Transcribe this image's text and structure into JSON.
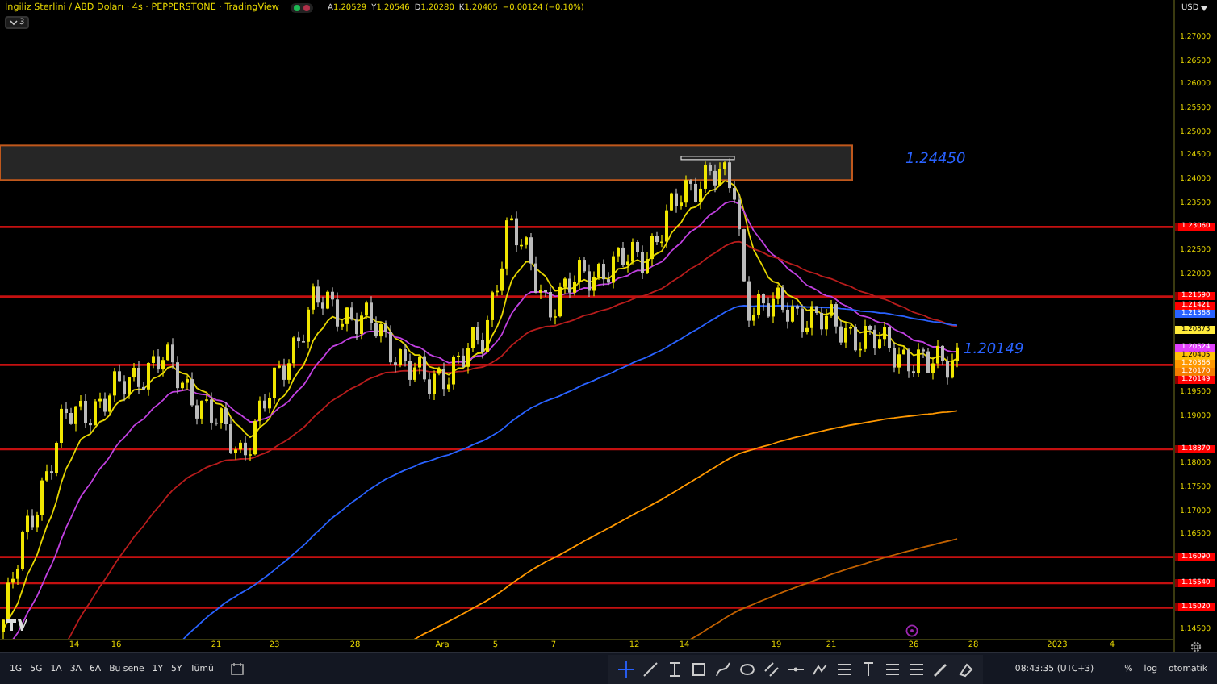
{
  "header": {
    "title": "İngiliz Sterlini / ABD Doları · 4s · PEPPERSTONE · TradingView",
    "market_open": true,
    "ohlc": [
      {
        "label": "A",
        "value": "1.20529"
      },
      {
        "label": "Y",
        "value": "1.20546"
      },
      {
        "label": "D",
        "value": "1.20280"
      },
      {
        "label": "K",
        "value": "1.20405"
      },
      {
        "value": "−0.00124 (−0.10%)"
      }
    ],
    "indicators_toggle": "3"
  },
  "chart": {
    "zone_label": "1.24450",
    "level_label": "1.20149"
  },
  "price_axis": {
    "currency": "USD",
    "ticks": [
      "1.27000",
      "1.26500",
      "1.26000",
      "1.25500",
      "1.25000",
      "1.24500",
      "1.24000",
      "1.23500",
      "1.22500",
      "1.22000",
      "1.19500",
      "1.19000",
      "1.18000",
      "1.17500",
      "1.17000",
      "1.16500",
      "1.14500"
    ],
    "badges": [
      {
        "value": "1.23060",
        "color": "#ff0000",
        "line": true
      },
      {
        "value": "1.21590",
        "color": "#ff0000",
        "line": true
      },
      {
        "value": "1.21421",
        "color": "#ff0000",
        "line": false
      },
      {
        "value": "1.21368",
        "color": "#2962ff",
        "line": false
      },
      {
        "value": "1.20873",
        "color": "#ffeb3b",
        "line": false
      },
      {
        "value": "1.20524",
        "color": "#e040fb",
        "line": false
      },
      {
        "value": "1.20405",
        "color": "#ffc107",
        "line": false
      },
      {
        "value": "1.20366",
        "color": "#ff9800",
        "line": false
      },
      {
        "value": "1.20170",
        "color": "#f57c00",
        "line": false
      },
      {
        "value": "1.20149",
        "color": "#ff0000",
        "line": true
      },
      {
        "value": "1.18370",
        "color": "#ff0000",
        "line": true
      },
      {
        "value": "1.16090",
        "color": "#ff0000",
        "line": true
      },
      {
        "value": "1.15540",
        "color": "#ff0000",
        "line": true
      },
      {
        "value": "1.15020",
        "color": "#ff0000",
        "line": true
      }
    ]
  },
  "time_axis": [
    "14",
    "16",
    "21",
    "23",
    "28",
    "Ara",
    "5",
    "7",
    "12",
    "14",
    "19",
    "21",
    "26",
    "28",
    "2023",
    "4"
  ],
  "bottom_bar": {
    "ranges": [
      "1G",
      "5G",
      "1A",
      "3A",
      "6A",
      "Bu sene",
      "1Y",
      "5Y",
      "Tümü"
    ],
    "clock": "08:43:35 (UTC+3)",
    "percent": "%",
    "log": "log",
    "auto": "otomatik"
  }
}
